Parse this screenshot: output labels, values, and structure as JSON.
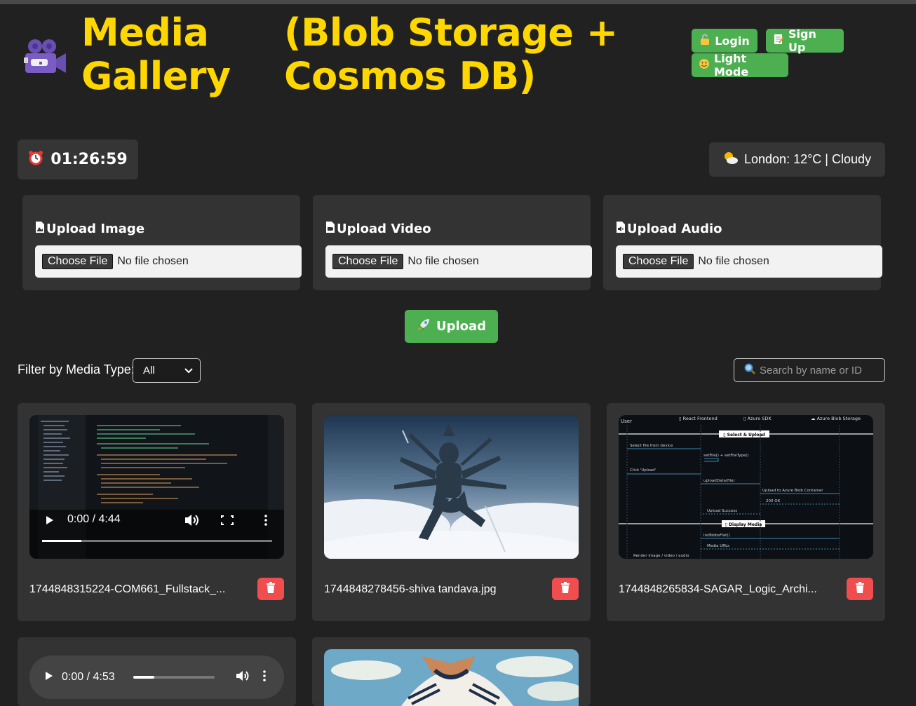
{
  "header": {
    "title_left": "Media Gallery",
    "title_left_l1": "Media",
    "title_left_l2": "Gallery",
    "title_right_l1": "(Blob Storage +",
    "title_right_l2": "Cosmos DB)",
    "logo_icon": "video-camera-icon",
    "buttons": {
      "login": "Login",
      "signup": "Sign Up",
      "light_mode": "Light Mode"
    }
  },
  "clock": {
    "time": "01:26:59",
    "icon": "alarm-clock-icon"
  },
  "weather": {
    "text": "London: 12°C | Cloudy",
    "icon": "sun-behind-cloud-icon"
  },
  "uploads": [
    {
      "label": "Upload Image",
      "button": "Choose File",
      "status": "No file chosen"
    },
    {
      "label": "Upload Video",
      "button": "Choose File",
      "status": "No file chosen"
    },
    {
      "label": "Upload Audio",
      "button": "Choose File",
      "status": "No file chosen"
    }
  ],
  "upload_button": "Upload",
  "filter": {
    "label": "Filter by Media Type:",
    "selected": "All"
  },
  "search": {
    "placeholder": "Search by name or ID"
  },
  "media": [
    {
      "type": "video",
      "name": "1744848315224-COM661_Fullstack_...",
      "time": "0:00 / 4:44"
    },
    {
      "type": "image",
      "name": "1744848278456-shiva tandava.jpg"
    },
    {
      "type": "image",
      "name": "1744848265834-SAGAR_Logic_Archi...",
      "diagram": {
        "lanes": [
          "User",
          "▯ React Frontend",
          "▯ Azure SDK",
          "☁ Azure Blob Storage"
        ],
        "section1": "▯ Select & Upload",
        "section2": "▯ Display Media",
        "msgs": [
          "Select file from device",
          "setFile() + setFileType()",
          "Click 'Upload'",
          "uploadData(file)",
          "Upload to Azure Blob Container",
          "200 OK",
          "Upload Success",
          "listBlobsFlat()",
          "Media URLs",
          "Render image / video / audio"
        ]
      }
    },
    {
      "type": "audio",
      "time": "0:00 / 4:53"
    },
    {
      "type": "image",
      "name": ""
    }
  ],
  "colors": {
    "accent_yellow": "#ffd700",
    "green": "#4caf50",
    "delete_red": "#f04e4e",
    "bg": "#212121",
    "card": "#333333"
  }
}
